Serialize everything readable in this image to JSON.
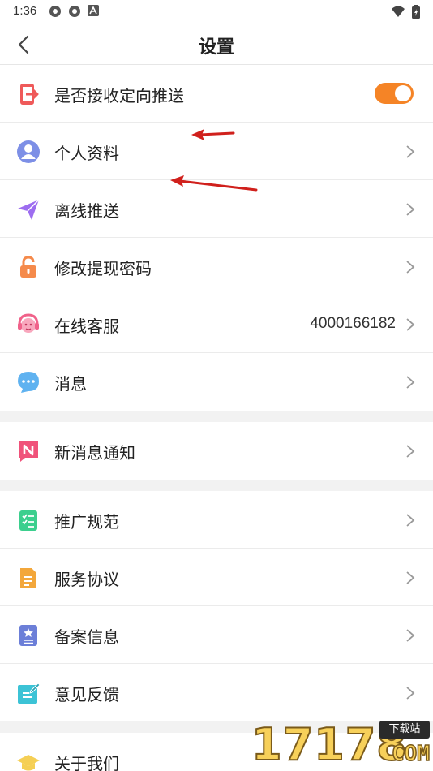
{
  "status_bar": {
    "time": "1:36"
  },
  "header": {
    "title": "设置"
  },
  "rows": [
    {
      "label": "是否接收定向推送",
      "icon": "push-phone-icon",
      "toggle_on": true
    },
    {
      "label": "个人资料",
      "icon": "user-icon"
    },
    {
      "label": "离线推送",
      "icon": "paper-plane-icon"
    },
    {
      "label": "修改提现密码",
      "icon": "lock-icon"
    },
    {
      "label": "在线客服",
      "icon": "customer-service-icon",
      "value": "4000166182"
    },
    {
      "label": "消息",
      "icon": "chat-bubble-icon"
    },
    {
      "label": "新消息通知",
      "icon": "notification-n-icon"
    },
    {
      "label": "推广规范",
      "icon": "checklist-icon"
    },
    {
      "label": "服务协议",
      "icon": "document-icon"
    },
    {
      "label": "备案信息",
      "icon": "record-star-icon"
    },
    {
      "label": "意见反馈",
      "icon": "feedback-edit-icon"
    },
    {
      "label": "关于我们",
      "icon": "graduation-cap-icon"
    }
  ],
  "watermark": {
    "number": "17178",
    "badge": "下载站",
    "suffix": "COM"
  },
  "colors": {
    "accent": "#f58426",
    "annotation_arrow": "#d0201c"
  }
}
